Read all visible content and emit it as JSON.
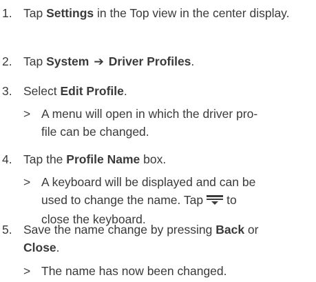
{
  "steps": [
    {
      "num": "1.",
      "pre": "Tap ",
      "bold": "Settings",
      "post": " in the Top view in the center display."
    },
    {
      "num": "2.",
      "pre": "Tap ",
      "bold1": "System",
      "arrow": "➔",
      "bold2": "Driver Profiles",
      "post": "."
    },
    {
      "num": "3.",
      "pre": "Select ",
      "bold": "Edit Profile",
      "post": ".",
      "result_marker": ">",
      "result_line1": "A menu will open in which the driver pro-",
      "result_line2": "file can be changed."
    },
    {
      "num": "4.",
      "pre": "Tap the ",
      "bold": "Profile Name",
      "post": " box.",
      "result_marker": ">",
      "result_line1": "A keyboard will be displayed and can be",
      "result_line2_pre": "used to change the name. Tap",
      "result_line2_post": "to",
      "result_line3": "close the keyboard.",
      "icon": "keyboard-close-icon"
    },
    {
      "num": "5.",
      "pre": "Save the name change by pressing ",
      "bold1": "Back",
      "mid": " or",
      "bold2": "Close",
      "post": ".",
      "result_marker": ">",
      "result_line1": "The name has now been changed."
    }
  ]
}
